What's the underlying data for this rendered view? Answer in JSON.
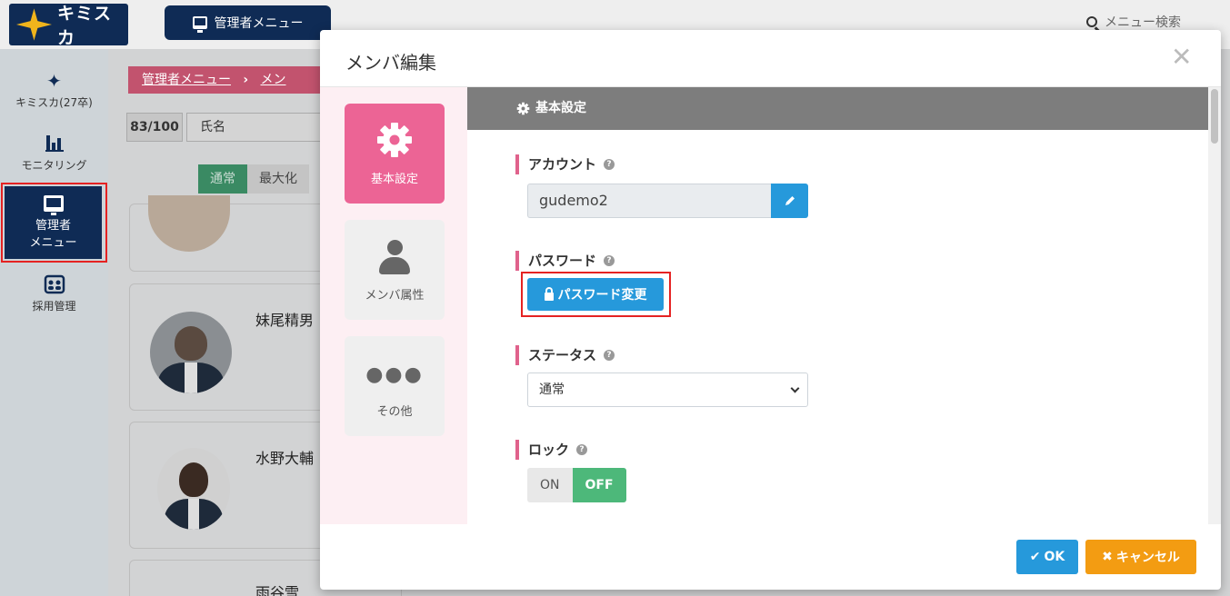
{
  "app": {
    "logo_text": "キミスカ",
    "admin_menu_button": "管理者メニュー",
    "menu_search_placeholder": "メニュー検索"
  },
  "sidebar": {
    "items": [
      {
        "label": "キミスカ(27卒)",
        "icon": "star-icon"
      },
      {
        "label": "モニタリング",
        "icon": "chart-icon"
      },
      {
        "label_line1": "管理者",
        "label_line2": "メニュー",
        "icon": "monitor-icon",
        "active": true
      },
      {
        "label": "採用管理",
        "icon": "id-card-icon"
      }
    ]
  },
  "background": {
    "breadcrumb_root": "管理者メニュー",
    "breadcrumb_sep": "›",
    "breadcrumb_current": "メン",
    "count": "83/100",
    "sort_value": "氏名",
    "view_normal": "通常",
    "view_max": "最大化",
    "cards": [
      {
        "name": "妹尾精男"
      },
      {
        "name": "水野大輔"
      },
      {
        "name": "雨谷雪"
      }
    ]
  },
  "modal": {
    "title": "メンバ編集",
    "close": "✕",
    "tabs": [
      {
        "label": "基本設定",
        "active": true
      },
      {
        "label": "メンバ属性",
        "active": false
      },
      {
        "label": "その他",
        "active": false
      }
    ],
    "section_header": "基本設定",
    "fields": {
      "account_label": "アカウント",
      "account_value": "gudemo2",
      "password_label": "パスワード",
      "password_button": "パスワード変更",
      "status_label": "ステータス",
      "status_value": "通常",
      "lock_label": "ロック",
      "lock_on": "ON",
      "lock_off": "OFF"
    },
    "ok_button": "OK",
    "cancel_button": "キャンセル"
  },
  "colors": {
    "navy": "#0f2b55",
    "pink_tab": "#ec6495",
    "primary_blue": "#2699db",
    "cancel_orange": "#f39c12",
    "toggle_green": "#4db87a",
    "highlight_red": "#e52222"
  }
}
